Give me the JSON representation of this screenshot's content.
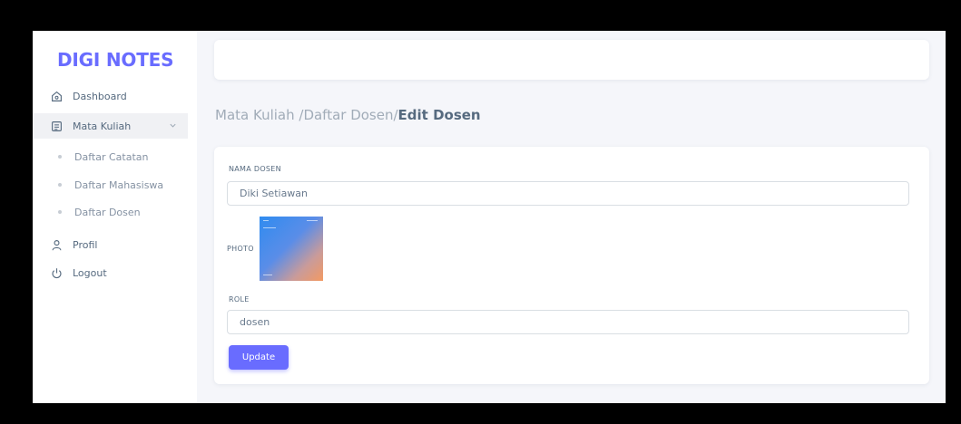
{
  "brand": {
    "name": "DIGI NOTES"
  },
  "sidebar": {
    "items": [
      {
        "label": "Dashboard",
        "icon": "home-icon"
      },
      {
        "label": "Mata Kuliah",
        "icon": "notes-icon"
      },
      {
        "label": "Profil",
        "icon": "user-icon"
      },
      {
        "label": "Logout",
        "icon": "power-icon"
      }
    ],
    "subitems": [
      {
        "label": "Daftar Catatan"
      },
      {
        "label": "Daftar Mahasiswa"
      },
      {
        "label": "Daftar Dosen"
      }
    ]
  },
  "breadcrumb": {
    "part1": "Mata Kuliah /",
    "part2": "Daftar Dosen/",
    "current": "Edit Dosen"
  },
  "form": {
    "name_label": "NAMA DOSEN",
    "name_value": "Diki Setiawan",
    "photo_label": "PHOTO",
    "role_label": "ROLE",
    "role_value": "dosen",
    "submit_label": "Update"
  },
  "colors": {
    "accent": "#696cff",
    "text": "#566a7f",
    "muted": "#a1acb8",
    "background": "#f5f6fa"
  }
}
